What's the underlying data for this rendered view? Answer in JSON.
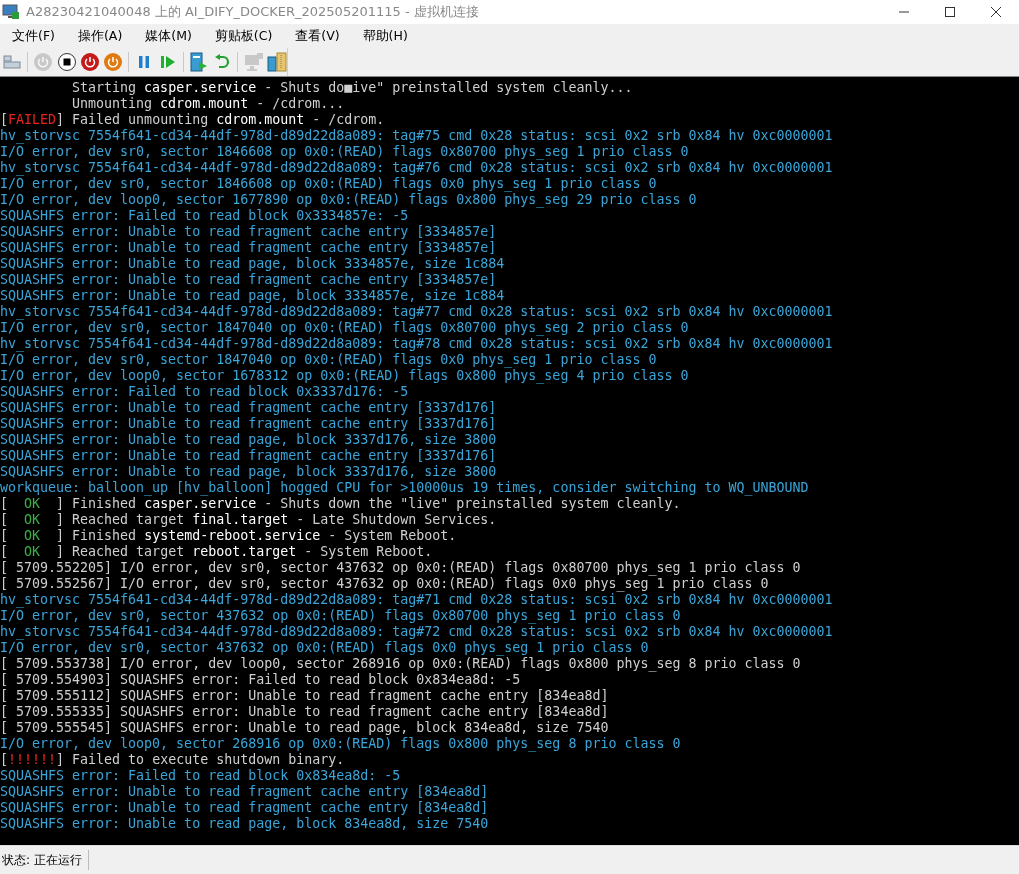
{
  "window": {
    "title": "A28230421040048 上的 AI_DIFY_DOCKER_202505201115 - 虚拟机连接"
  },
  "menu": [
    {
      "label": "文件(F)"
    },
    {
      "label": "操作(A)"
    },
    {
      "label": "媒体(M)"
    },
    {
      "label": "剪贴板(C)"
    },
    {
      "label": "查看(V)"
    },
    {
      "label": "帮助(H)"
    }
  ],
  "toolbar": [
    {
      "kind": "keyboard",
      "disabled": false
    },
    {
      "kind": "separator"
    },
    {
      "kind": "start",
      "disabled": true
    },
    {
      "kind": "stop",
      "disabled": false
    },
    {
      "kind": "shutdown",
      "disabled": false
    },
    {
      "kind": "save",
      "disabled": false
    },
    {
      "kind": "separator"
    },
    {
      "kind": "pause",
      "disabled": false
    },
    {
      "kind": "play",
      "disabled": false
    },
    {
      "kind": "separator"
    },
    {
      "kind": "checkpoint",
      "disabled": false
    },
    {
      "kind": "revert",
      "disabled": false
    },
    {
      "kind": "separator"
    },
    {
      "kind": "session",
      "disabled": true
    },
    {
      "kind": "share",
      "disabled": false
    }
  ],
  "console": [
    {
      "segments": [
        {
          "text": "         Starting ",
          "kind": "white"
        },
        {
          "text": "casper.service",
          "kind": "bright"
        },
        {
          "text": " - Shuts do■ive\" preinstalled system cleanly...",
          "kind": "white"
        }
      ]
    },
    {
      "segments": [
        {
          "text": "         Unmounting ",
          "kind": "white"
        },
        {
          "text": "cdrom.mount",
          "kind": "bright"
        },
        {
          "text": " - /cdrom...",
          "kind": "white"
        }
      ]
    },
    {
      "segments": [
        {
          "text": "[",
          "kind": "white"
        },
        {
          "text": "FAILED",
          "kind": "red"
        },
        {
          "text": "] Failed unmounting ",
          "kind": "white"
        },
        {
          "text": "cdrom.mount",
          "kind": "bright"
        },
        {
          "text": " - /cdrom.",
          "kind": "white"
        }
      ]
    },
    {
      "segments": [
        {
          "text": "hv_storvsc 7554f641-cd34-44df-978d-d89d22d8a089: tag#75 cmd 0x28 status: scsi 0x2 srb 0x84 hv 0xc0000001",
          "kind": "cyan"
        }
      ]
    },
    {
      "segments": [
        {
          "text": "I/O error, dev sr0, sector 1846608 op 0x0:(READ) flags 0x80700 phys_seg 1 prio class 0",
          "kind": "cyan"
        }
      ]
    },
    {
      "segments": [
        {
          "text": "hv_storvsc 7554f641-cd34-44df-978d-d89d22d8a089: tag#76 cmd 0x28 status: scsi 0x2 srb 0x84 hv 0xc0000001",
          "kind": "cyan"
        }
      ]
    },
    {
      "segments": [
        {
          "text": "I/O error, dev sr0, sector 1846608 op 0x0:(READ) flags 0x0 phys_seg 1 prio class 0",
          "kind": "cyan"
        }
      ]
    },
    {
      "segments": [
        {
          "text": "I/O error, dev loop0, sector 1677890 op 0x0:(READ) flags 0x800 phys_seg 29 prio class 0",
          "kind": "cyan"
        }
      ]
    },
    {
      "segments": [
        {
          "text": "SQUASHFS error: Failed to read block 0x3334857e: -5",
          "kind": "cyan"
        }
      ]
    },
    {
      "segments": [
        {
          "text": "SQUASHFS error: Unable to read fragment cache entry [3334857e]",
          "kind": "cyan"
        }
      ]
    },
    {
      "segments": [
        {
          "text": "SQUASHFS error: Unable to read fragment cache entry [3334857e]",
          "kind": "cyan"
        }
      ]
    },
    {
      "segments": [
        {
          "text": "SQUASHFS error: Unable to read page, block 3334857e, size 1c884",
          "kind": "cyan"
        }
      ]
    },
    {
      "segments": [
        {
          "text": "SQUASHFS error: Unable to read fragment cache entry [3334857e]",
          "kind": "cyan"
        }
      ]
    },
    {
      "segments": [
        {
          "text": "SQUASHFS error: Unable to read page, block 3334857e, size 1c884",
          "kind": "cyan"
        }
      ]
    },
    {
      "segments": [
        {
          "text": "hv_storvsc 7554f641-cd34-44df-978d-d89d22d8a089: tag#77 cmd 0x28 status: scsi 0x2 srb 0x84 hv 0xc0000001",
          "kind": "cyan"
        }
      ]
    },
    {
      "segments": [
        {
          "text": "I/O error, dev sr0, sector 1847040 op 0x0:(READ) flags 0x80700 phys_seg 2 prio class 0",
          "kind": "cyan"
        }
      ]
    },
    {
      "segments": [
        {
          "text": "hv_storvsc 7554f641-cd34-44df-978d-d89d22d8a089: tag#78 cmd 0x28 status: scsi 0x2 srb 0x84 hv 0xc0000001",
          "kind": "cyan"
        }
      ]
    },
    {
      "segments": [
        {
          "text": "I/O error, dev sr0, sector 1847040 op 0x0:(READ) flags 0x0 phys_seg 1 prio class 0",
          "kind": "cyan"
        }
      ]
    },
    {
      "segments": [
        {
          "text": "I/O error, dev loop0, sector 1678312 op 0x0:(READ) flags 0x800 phys_seg 4 prio class 0",
          "kind": "cyan"
        }
      ]
    },
    {
      "segments": [
        {
          "text": "SQUASHFS error: Failed to read block 0x3337d176: -5",
          "kind": "cyan"
        }
      ]
    },
    {
      "segments": [
        {
          "text": "SQUASHFS error: Unable to read fragment cache entry [3337d176]",
          "kind": "cyan"
        }
      ]
    },
    {
      "segments": [
        {
          "text": "SQUASHFS error: Unable to read fragment cache entry [3337d176]",
          "kind": "cyan"
        }
      ]
    },
    {
      "segments": [
        {
          "text": "SQUASHFS error: Unable to read page, block 3337d176, size 3800",
          "kind": "cyan"
        }
      ]
    },
    {
      "segments": [
        {
          "text": "SQUASHFS error: Unable to read fragment cache entry [3337d176]",
          "kind": "cyan"
        }
      ]
    },
    {
      "segments": [
        {
          "text": "SQUASHFS error: Unable to read page, block 3337d176, size 3800",
          "kind": "cyan"
        }
      ]
    },
    {
      "segments": [
        {
          "text": "workqueue: balloon_up [hv_balloon] hogged CPU for >10000us 19 times, consider switching to WQ_UNBOUND",
          "kind": "cyan"
        }
      ]
    },
    {
      "segments": [
        {
          "text": "[  ",
          "kind": "white"
        },
        {
          "text": "OK",
          "kind": "green"
        },
        {
          "text": "  ] Finished ",
          "kind": "white"
        },
        {
          "text": "casper.service",
          "kind": "bright"
        },
        {
          "text": " - Shuts down the \"live\" preinstalled system cleanly.",
          "kind": "white"
        }
      ]
    },
    {
      "segments": [
        {
          "text": "[  ",
          "kind": "white"
        },
        {
          "text": "OK",
          "kind": "green"
        },
        {
          "text": "  ] Reached target ",
          "kind": "white"
        },
        {
          "text": "final.target",
          "kind": "bright"
        },
        {
          "text": " - Late Shutdown Services.",
          "kind": "white"
        }
      ]
    },
    {
      "segments": [
        {
          "text": "[  ",
          "kind": "white"
        },
        {
          "text": "OK",
          "kind": "green"
        },
        {
          "text": "  ] Finished ",
          "kind": "white"
        },
        {
          "text": "systemd-reboot.service",
          "kind": "bright"
        },
        {
          "text": " - System Reboot.",
          "kind": "white"
        }
      ]
    },
    {
      "segments": [
        {
          "text": "[  ",
          "kind": "white"
        },
        {
          "text": "OK",
          "kind": "green"
        },
        {
          "text": "  ] Reached target ",
          "kind": "white"
        },
        {
          "text": "reboot.target",
          "kind": "bright"
        },
        {
          "text": " - System Reboot.",
          "kind": "white"
        }
      ]
    },
    {
      "segments": [
        {
          "text": "[ 5709.552205] I/O error, dev sr0, sector 437632 op 0x0:(READ) flags 0x80700 phys_seg 1 prio class 0",
          "kind": "white"
        }
      ]
    },
    {
      "segments": [
        {
          "text": "[ 5709.552567] I/O error, dev sr0, sector 437632 op 0x0:(READ) flags 0x0 phys_seg 1 prio class 0",
          "kind": "white"
        }
      ]
    },
    {
      "segments": [
        {
          "text": "hv_storvsc 7554f641-cd34-44df-978d-d89d22d8a089: tag#71 cmd 0x28 status: scsi 0x2 srb 0x84 hv 0xc0000001",
          "kind": "cyan"
        }
      ]
    },
    {
      "segments": [
        {
          "text": "I/O error, dev sr0, sector 437632 op 0x0:(READ) flags 0x80700 phys_seg 1 prio class 0",
          "kind": "cyan"
        }
      ]
    },
    {
      "segments": [
        {
          "text": "hv_storvsc 7554f641-cd34-44df-978d-d89d22d8a089: tag#72 cmd 0x28 status: scsi 0x2 srb 0x84 hv 0xc0000001",
          "kind": "cyan"
        }
      ]
    },
    {
      "segments": [
        {
          "text": "I/O error, dev sr0, sector 437632 op 0x0:(READ) flags 0x0 phys_seg 1 prio class 0",
          "kind": "cyan"
        }
      ]
    },
    {
      "segments": [
        {
          "text": "[ 5709.553738] I/O error, dev loop0, sector 268916 op 0x0:(READ) flags 0x800 phys_seg 8 prio class 0",
          "kind": "white"
        }
      ]
    },
    {
      "segments": [
        {
          "text": "[ 5709.554903] SQUASHFS error: Failed to read block 0x834ea8d: -5",
          "kind": "white"
        }
      ]
    },
    {
      "segments": [
        {
          "text": "[ 5709.555112] SQUASHFS error: Unable to read fragment cache entry [834ea8d]",
          "kind": "white"
        }
      ]
    },
    {
      "segments": [
        {
          "text": "[ 5709.555335] SQUASHFS error: Unable to read fragment cache entry [834ea8d]",
          "kind": "white"
        }
      ]
    },
    {
      "segments": [
        {
          "text": "[ 5709.555545] SQUASHFS error: Unable to read page, block 834ea8d, size 7540",
          "kind": "white"
        }
      ]
    },
    {
      "segments": [
        {
          "text": "I/O error, dev loop0, sector 268916 op 0x0:(READ) flags 0x800 phys_seg 8 prio class 0",
          "kind": "cyan"
        }
      ]
    },
    {
      "segments": [
        {
          "text": "[",
          "kind": "white"
        },
        {
          "text": "!!!!!!",
          "kind": "red"
        },
        {
          "text": "] Failed to execute shutdown binary.",
          "kind": "white"
        }
      ]
    },
    {
      "segments": [
        {
          "text": "SQUASHFS error: Failed to read block 0x834ea8d: -5",
          "kind": "cyan"
        }
      ]
    },
    {
      "segments": [
        {
          "text": "SQUASHFS error: Unable to read fragment cache entry [834ea8d]",
          "kind": "cyan"
        }
      ]
    },
    {
      "segments": [
        {
          "text": "SQUASHFS error: Unable to read fragment cache entry [834ea8d]",
          "kind": "cyan"
        }
      ]
    },
    {
      "segments": [
        {
          "text": "SQUASHFS error: Unable to read page, block 834ea8d, size 7540",
          "kind": "cyan"
        }
      ]
    }
  ],
  "status_bar": {
    "text": "状态: 正在运行"
  }
}
